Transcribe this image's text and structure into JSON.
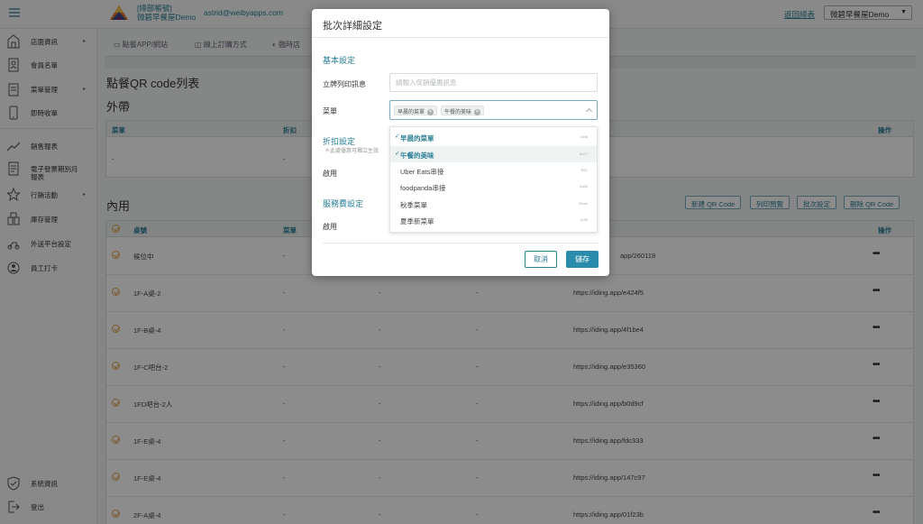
{
  "topbar": {
    "account_label": "[總部帳號]",
    "store_name": "微碧早餐屋Demo",
    "email": "astrid@weibyapps.com",
    "back_link": "返回總表",
    "store_select": "微碧早餐屋Demo"
  },
  "sidebar": {
    "items": [
      {
        "label": "店面資訊",
        "icon": "store-icon"
      },
      {
        "label": "會員名單",
        "icon": "member-card-icon"
      },
      {
        "label": "菜單管理",
        "icon": "menu-book-icon"
      },
      {
        "label": "即時收單",
        "icon": "tablet-icon"
      },
      {
        "label": "銷售報表",
        "icon": "trend-chart-icon"
      },
      {
        "label": "電子發票期別月報表",
        "icon": "invoice-icon"
      },
      {
        "label": "行銷活動",
        "icon": "gear-star-icon"
      },
      {
        "label": "庫存管理",
        "icon": "inventory-icon"
      },
      {
        "label": "外送平台設定",
        "icon": "scooter-icon"
      },
      {
        "label": "員工打卡",
        "icon": "staff-icon"
      }
    ],
    "bottom": [
      {
        "label": "系統資訊",
        "icon": "shield-icon"
      },
      {
        "label": "登出",
        "icon": "logout-icon"
      }
    ]
  },
  "main": {
    "subtabs": [
      "點餐APP/網站",
      "線上訂購方式",
      "臨時店"
    ],
    "page_title": "點餐QR code列表",
    "takeout": {
      "title": "外帶",
      "headers": [
        "菜單",
        "折扣",
        "操作"
      ],
      "row": [
        "-",
        "-"
      ]
    },
    "dinein": {
      "title": "內用",
      "buttons": [
        "新建 QR Code",
        "列印預覽",
        "批次設定",
        "刪除 QR Code"
      ],
      "headers": [
        "桌號",
        "菜單",
        "操作"
      ],
      "rows": [
        {
          "table": "候位中",
          "menu": "-",
          "url": "app/260119"
        },
        {
          "table": "1F-A桌-2",
          "menu": "-",
          "c3": "-",
          "c4": "-",
          "url": "https://iding.app/e424f5"
        },
        {
          "table": "1F-B桌-4",
          "menu": "-",
          "c3": "-",
          "c4": "-",
          "url": "https://iding.app/4f1be4"
        },
        {
          "table": "1F-C吧台-2",
          "menu": "-",
          "c3": "-",
          "c4": "-",
          "url": "https://iding.app/e35360"
        },
        {
          "table": "1FD吧台-2人",
          "menu": "-",
          "c3": "-",
          "c4": "-",
          "url": "https://iding.app/b0d9cf"
        },
        {
          "table": "1F-E桌-4",
          "menu": "-",
          "c3": "-",
          "c4": "-",
          "url": "https://iding.app/fdc333"
        },
        {
          "table": "1F-E桌-4",
          "menu": "-",
          "c3": "-",
          "c4": "-",
          "url": "https://iding.app/147c97"
        },
        {
          "table": "2F-A桌-4",
          "menu": "-",
          "c3": "-",
          "c4": "-",
          "url": "https://iding.app/01f23b"
        }
      ]
    }
  },
  "modal": {
    "title": "批次詳細設定",
    "basic_section": "基本設定",
    "print_label": "立牌列印訊息",
    "print_placeholder": "請輸入促銷優惠訊息",
    "menu_label": "菜單",
    "selected_tags": [
      "早晨的菜單",
      "午餐的美味"
    ],
    "discount_section": "折扣設定",
    "discount_hint": "＊此處優惠可獨立生效",
    "discount_enable": "啟用",
    "service_section": "服務費設定",
    "service_enable": "啟用",
    "dropdown_options": [
      {
        "name": "早晨的菜單",
        "code": "44fa",
        "selected": true
      },
      {
        "name": "午餐的美味",
        "code": "8a77",
        "selected": true
      },
      {
        "name": "Uber Eats串接",
        "code": "3f51",
        "selected": false
      },
      {
        "name": "foodpanda串接",
        "code": "5d8b",
        "selected": false
      },
      {
        "name": "秋季菜單",
        "code": "4f1ea",
        "selected": false
      },
      {
        "name": "夏季新菜單",
        "code": "1138",
        "selected": false
      }
    ],
    "cancel": "取消",
    "save": "儲存"
  },
  "colors": {
    "accent": "#2a8bab",
    "accent_text": "#2a7f96",
    "check_orange": "#e0a44a"
  }
}
